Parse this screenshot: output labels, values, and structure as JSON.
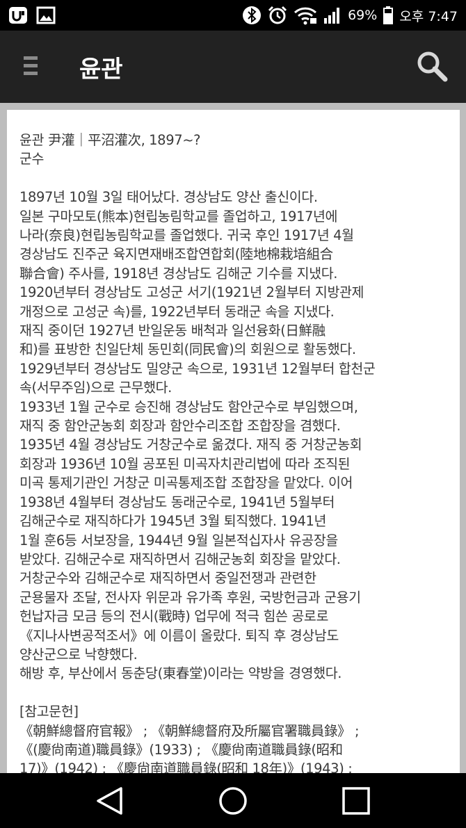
{
  "status_bar": {
    "battery": "69%",
    "time": "오후 7:47"
  },
  "toolbar": {
    "title": "윤관"
  },
  "article": {
    "lines": [
      "윤관 尹灌｜平沼灌次, 1897~?",
      "군수",
      "",
      "1897년 10월 3일 태어났다. 경상남도 양산 출신이다.",
      "일본 구마모토(熊本)현립농림학교를 졸업하고, 1917년에",
      "나라(奈良)현립농림학교를 졸업했다. 귀국 후인 1917년 4월",
      "경상남도 진주군 육지면재배조합연합회(陸地棉栽培組合",
      "聯合會) 주사를, 1918년 경상남도 김해군 기수를 지냈다.",
      "1920년부터 경상남도 고성군 서기(1921년 2월부터 지방관제",
      "개정으로 고성군 속)를, 1922년부터 동래군 속을 지냈다.",
      "재직 중이던 1927년 반일운동 배척과 일선융화(日鮮融",
      "和)를 표방한 친일단체 동민회(同民會)의 회원으로 활동했다.",
      "1929년부터 경상남도 밀양군 속으로, 1931년 12월부터 합천군",
      "속(서무주임)으로 근무했다.",
      "1933년 1월 군수로 승진해 경상남도 함안군수로 부임했으며,",
      "재직 중 함안군농회 회장과 함안수리조합 조합장을 겸했다.",
      "1935년 4월 경상남도 거창군수로 옮겼다. 재직 중 거창군농회",
      "회장과 1936년 10월 공포된 미곡자치관리법에 따라 조직된",
      "미곡 통제기관인 거창군 미곡통제조합 조합장을 맡았다. 이어",
      "1938년 4월부터 경상남도 동래군수로, 1941년 5월부터",
      "김해군수로 재직하다가 1945년 3월 퇴직했다. 1941년",
      "1월 훈6등 서보장을, 1944년 9월 일본적십자사 유공장을",
      "받았다. 김해군수로 재직하면서 김해군농회 회장을 맡았다.",
      "거창군수와 김해군수로 재직하면서 중일전쟁과 관련한",
      "군용물자 조달, 전사자 위문과 유가족 후원, 국방헌금과 군용기",
      "헌납자금 모금 등의 전시(戰時) 업무에 적극 힘쓴 공로로",
      "《지나사변공적조서》에 이름이 올랐다. 퇴직 후 경상남도",
      "양산군으로 낙향했다.",
      "해방 후, 부산에서 동춘당(東春堂)이라는 약방을 경영했다.",
      "",
      "[참고문헌]",
      "《朝鮮總督府官報》 ; 《朝鮮總督府及所屬官署職員錄》 ;",
      "《(慶尙南道)職員錄》(1933) ; 《慶尙南道職員錄(昭和",
      "17)》(1942) ; 《慶尙南道職員錄(昭和 18年)》(1943) ;"
    ]
  }
}
